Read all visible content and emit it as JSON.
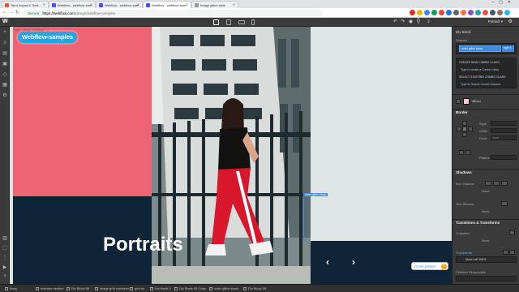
{
  "browser": {
    "tabs": [
      {
        "label": "Tarot Impact // Seci...",
        "favicon_color": "#e85a3a",
        "active": false
      },
      {
        "label": "Webflow - webflow-sam...",
        "favicon_color": "#4353ff",
        "active": false
      },
      {
        "label": "Webflow - webflow-sam...",
        "favicon_color": "#4353ff",
        "active": false
      },
      {
        "label": "Webflow - webflow-sam...",
        "favicon_color": "#4353ff",
        "active": true
      },
      {
        "label": "Image glitch slide",
        "favicon_color": "#999999",
        "active": false
      }
    ],
    "secure_label": "Secure",
    "url_host": "https://webflow.com",
    "url_path": "/design/webflow-samples",
    "extension_colors": [
      "#d93025",
      "#f4b400",
      "#4285f4",
      "#0f9d58",
      "#ea4335",
      "#1a73e8",
      "#5f6368",
      "#ff7043",
      "#7e57c2",
      "#26a69a",
      "#ef5350",
      "#455a64",
      "#8d6e63",
      "#29b6f6"
    ]
  },
  "webflow": {
    "logo": "W",
    "publish_label": "Publish ▾",
    "page_info": "Page: Image desktop - ⌄"
  },
  "canvas": {
    "badge": "Webflow-samples",
    "title": "Portraits",
    "prev_arrow": "‹",
    "next_arrow": "›",
    "clone_label": "Clone project",
    "clone_count": "6",
    "selection_label": "outer glitch block"
  },
  "style_panel": {
    "element": "Div Block",
    "selector_label": "Selector",
    "class_chip": "outer glitch block",
    "class_chip2": "right 2",
    "combo_menu": [
      "CREATE NEW COMBO CLASS",
      "Type to create a Combo Class",
      "SELECT EXISTING COMBO CLASS",
      "Type to Search Combo Classes"
    ],
    "color_value": "#ffccd",
    "border_header": "Border",
    "style_label": "Style",
    "width_label": "Width",
    "color_label": "Color",
    "radius_label": "Radius",
    "shadows_header": "Shadows",
    "box_shadow_label": "Box Shadow",
    "text_shadow_label": "Text Shadow",
    "none_label": "None",
    "transitions_header": "Transitions & Transforms",
    "transition_label": "Transition",
    "transforms_label": "Transforms",
    "transform_value": "Move Left 100%",
    "children_perspective_label": "Children Perspective"
  },
  "breadcrumbs": [
    "Body",
    "member section",
    "Div Block 56",
    "image grid container",
    "grid bn",
    "Div block 3",
    "Div Block 59 Copy",
    "outer glitch block",
    "Div Block 58"
  ]
}
